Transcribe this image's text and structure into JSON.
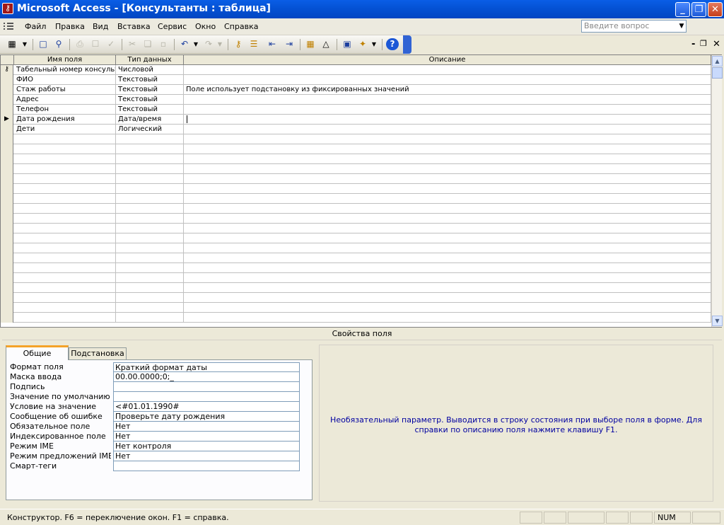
{
  "window": {
    "title": "Microsoft Access - [Консультанты : таблица]",
    "app_icon": "access-key-icon",
    "controls": {
      "minimize": "_",
      "maximize": "❐",
      "close": "✕"
    }
  },
  "menu": {
    "items": [
      "Файл",
      "Правка",
      "Вид",
      "Вставка",
      "Сервис",
      "Окно",
      "Справка"
    ],
    "ask_placeholder": "Введите вопрос",
    "mdi_controls": {
      "minimize": "-",
      "restore": "❐",
      "close": "✕"
    }
  },
  "toolbar": {
    "icons": [
      "view-icon",
      "view-dropdown-icon",
      "save-icon",
      "search-icon",
      "print-icon",
      "print-preview-icon",
      "spelling-icon",
      "cut-icon",
      "copy-icon",
      "paste-icon",
      "undo-icon",
      "undo-dropdown-icon",
      "redo-icon",
      "redo-dropdown-icon",
      "primary-key-icon",
      "indexes-icon",
      "insert-rows-icon",
      "delete-rows-icon",
      "properties-icon",
      "build-icon",
      "database-window-icon",
      "new-object-icon",
      "new-object-dropdown-icon",
      "help-icon"
    ]
  },
  "grid": {
    "columns": [
      "Имя поля",
      "Тип данных",
      "Описание"
    ],
    "rows": [
      {
        "name": "Табельный номер консульт",
        "type": "Числовой",
        "description": "",
        "selector": "key"
      },
      {
        "name": "ФИО",
        "type": "Текстовый",
        "description": "",
        "selector": ""
      },
      {
        "name": "Стаж работы",
        "type": "Текстовый",
        "description": "Поле использует подстановку из фиксированных значений",
        "selector": ""
      },
      {
        "name": "Адрес",
        "type": "Текстовый",
        "description": "",
        "selector": ""
      },
      {
        "name": "Телефон",
        "type": "Текстовый",
        "description": "",
        "selector": ""
      },
      {
        "name": "Дата рождения",
        "type": "Дата/время",
        "description": "",
        "selector": "current"
      },
      {
        "name": "Дети",
        "type": "Логический",
        "description": "",
        "selector": ""
      }
    ],
    "empty_rows": 19
  },
  "properties": {
    "section_title": "Свойства поля",
    "tabs": [
      "Общие",
      "Подстановка"
    ],
    "active_tab": "Общие",
    "rows": [
      {
        "label": "Формат поля",
        "value": "Краткий формат даты"
      },
      {
        "label": "Маска ввода",
        "value": "00.00.0000;0;_"
      },
      {
        "label": "Подпись",
        "value": ""
      },
      {
        "label": "Значение по умолчанию",
        "value": ""
      },
      {
        "label": "Условие на значение",
        "value": "<#01.01.1990#"
      },
      {
        "label": "Сообщение об ошибке",
        "value": "Проверьте дату рождения"
      },
      {
        "label": "Обязательное поле",
        "value": "Нет"
      },
      {
        "label": "Индексированное поле",
        "value": "Нет"
      },
      {
        "label": "Режим IME",
        "value": "Нет контроля"
      },
      {
        "label": "Режим предложений IME",
        "value": "Нет"
      },
      {
        "label": "Смарт-теги",
        "value": ""
      }
    ],
    "help": "Необязательный параметр.  Выводится в строку состояния при выборе поля в форме.  Для справки по описанию поля нажмите клавишу F1."
  },
  "status": {
    "text": "Конструктор.  F6 = переключение окон.  F1 = справка.",
    "num": "NUM"
  },
  "colors": {
    "title_bar": "#0553d6",
    "help_text": "#0000a0",
    "chrome": "#ece9d8"
  }
}
